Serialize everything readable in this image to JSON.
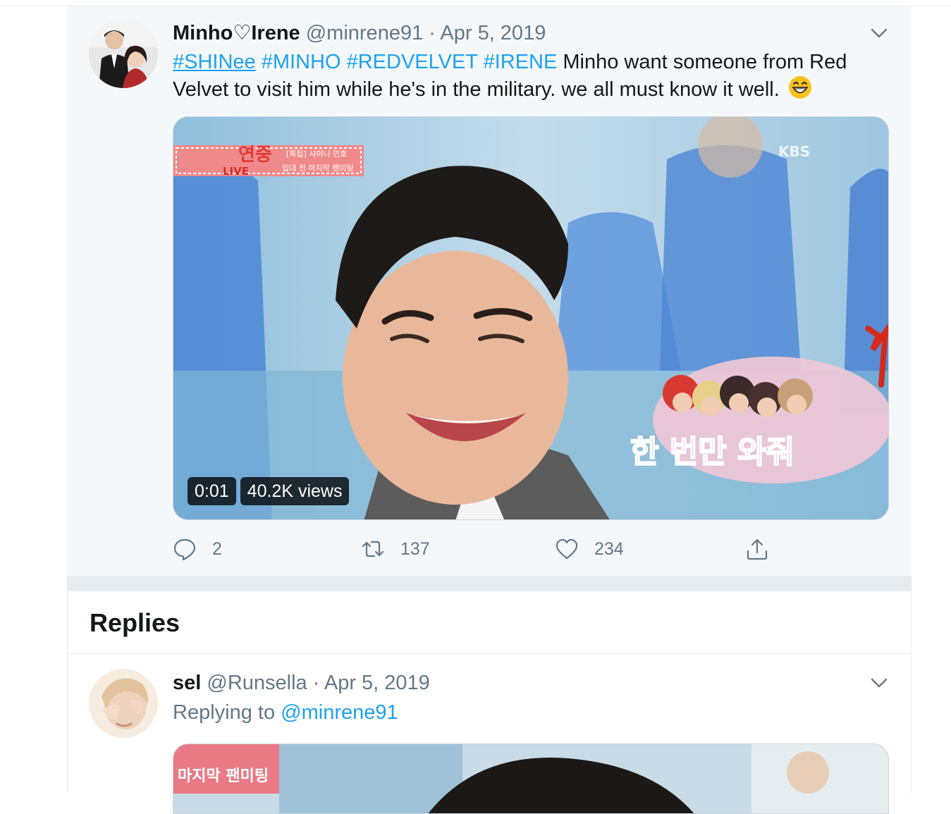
{
  "tweet": {
    "author": {
      "name": "Minho♡Irene",
      "handle": "@minrene91",
      "date": "· Apr 5, 2019"
    },
    "hashtags": [
      "#SHINee",
      "#MINHO",
      "#REDVELVET",
      "#IRENE"
    ],
    "text": "Minho want someone from Red Velvet to visit him while he's in the military. we all must know it well.",
    "emoji": "grinning-face-with-smiling-eyes",
    "video": {
      "duration": "0:01",
      "views": "40.2K views",
      "overlay": {
        "show": "연중",
        "live": "LIVE",
        "caption_small_1": "[특집] 샤이니 민호",
        "caption_small_2": "입대 전 마지막 팬미팅",
        "network": "KBS",
        "subtitle": "한 번만 와줘"
      }
    },
    "actions": {
      "replies": "2",
      "retweets": "137",
      "likes": "234"
    }
  },
  "replies_section": {
    "title": "Replies"
  },
  "reply": {
    "author": {
      "name": "sel",
      "handle": "@Runsella",
      "date": "· Apr 5, 2019"
    },
    "replying_prefix": "Replying to",
    "replying_handle": "@minrene91",
    "media_overlay_text": "마지막 팬미팅"
  },
  "colors": {
    "link": "#1da1f2",
    "muted": "#657786",
    "tweet_bg": "#f5f8fa",
    "divider": "#e6ecf0"
  }
}
